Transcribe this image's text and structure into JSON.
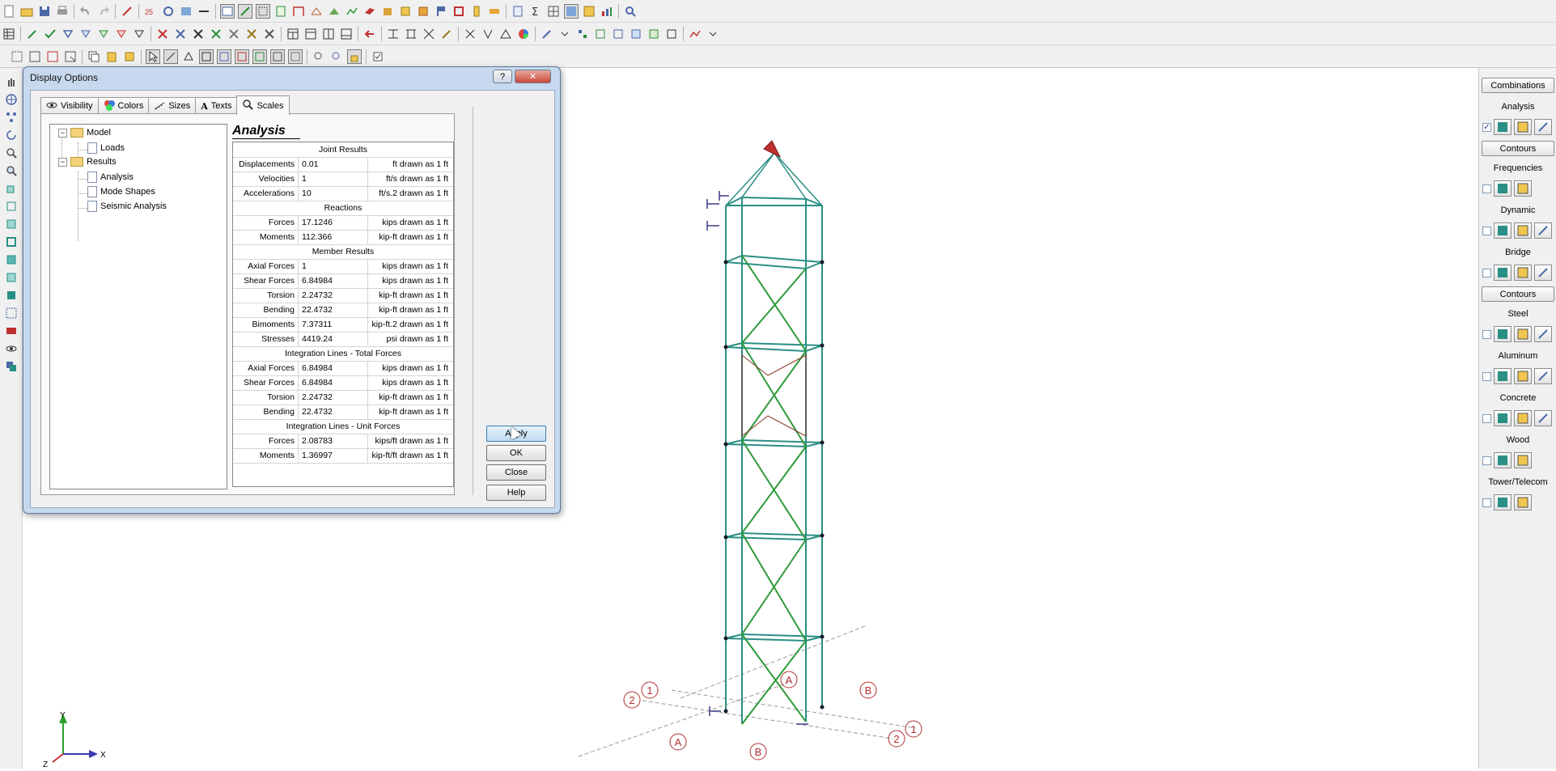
{
  "dialog": {
    "title": "Display Options",
    "help_glyph": "?",
    "close_glyph": "✕",
    "tabs": [
      {
        "label": "Visibility",
        "icon": "eye-icon"
      },
      {
        "label": "Colors",
        "icon": "palette-icon"
      },
      {
        "label": "Sizes",
        "icon": "ruler-icon"
      },
      {
        "label": "Texts",
        "icon": "text-a-icon"
      },
      {
        "label": "Scales",
        "icon": "magnifier-icon"
      }
    ],
    "active_tab": "Scales",
    "tree": [
      {
        "label": "Model",
        "type": "folder"
      },
      {
        "label": "Loads",
        "type": "doc"
      },
      {
        "label": "Results",
        "type": "folder"
      },
      {
        "label": "Analysis",
        "type": "doc",
        "selected": true
      },
      {
        "label": "Mode Shapes",
        "type": "doc"
      },
      {
        "label": "Seismic Analysis",
        "type": "doc"
      }
    ],
    "section_title": "Analysis",
    "grid": {
      "joint_header": "Joint Results",
      "displacements": {
        "label": "Displacements",
        "value": "0.01",
        "unit": "ft drawn as 1 ft"
      },
      "velocities": {
        "label": "Velocities",
        "value": "1",
        "unit": "ft/s drawn as 1 ft"
      },
      "accelerations": {
        "label": "Accelerations",
        "value": "10",
        "unit": "ft/s.2 drawn as 1 ft"
      },
      "reactions_header": "Reactions",
      "r_forces": {
        "label": "Forces",
        "value": "17.1246",
        "unit": "kips drawn as 1 ft"
      },
      "r_moments": {
        "label": "Moments",
        "value": "112.366",
        "unit": "kip-ft drawn as 1 ft"
      },
      "member_header": "Member Results",
      "m_axial": {
        "label": "Axial Forces",
        "value": "1",
        "unit": "kips drawn as 1 ft"
      },
      "m_shear": {
        "label": "Shear Forces",
        "value": "6.84984",
        "unit": "kips drawn as 1 ft"
      },
      "m_torsion": {
        "label": "Torsion",
        "value": "2.24732",
        "unit": "kip-ft drawn as 1 ft"
      },
      "m_bending": {
        "label": "Bending",
        "value": "22.4732",
        "unit": "kip-ft drawn as 1 ft"
      },
      "m_bimoments": {
        "label": "Bimoments",
        "value": "7.37311",
        "unit": "kip-ft.2 drawn as 1 ft"
      },
      "m_stresses": {
        "label": "Stresses",
        "value": "4419.24",
        "unit": "psi drawn as 1 ft"
      },
      "total_header": "Integration Lines - Total Forces",
      "t_axial": {
        "label": "Axial Forces",
        "value": "6.84984",
        "unit": "kips drawn as 1 ft"
      },
      "t_shear": {
        "label": "Shear Forces",
        "value": "6.84984",
        "unit": "kips drawn as 1 ft"
      },
      "t_torsion": {
        "label": "Torsion",
        "value": "2.24732",
        "unit": "kip-ft drawn as 1 ft"
      },
      "t_bending": {
        "label": "Bending",
        "value": "22.4732",
        "unit": "kip-ft drawn as 1 ft"
      },
      "unit_header": "Integration Lines - Unit Forces",
      "u_forces": {
        "label": "Forces",
        "value": "2.08783",
        "unit": "kips/ft drawn as 1 ft"
      },
      "u_moments": {
        "label": "Moments",
        "value": "1.36997",
        "unit": "kip-ft/ft drawn as 1 ft"
      }
    },
    "buttons": {
      "apply": "Apply",
      "ok": "OK",
      "close": "Close",
      "help": "Help"
    }
  },
  "right_panel": {
    "combinations": "Combinations",
    "analysis": "Analysis",
    "contours_1": "Contours",
    "frequencies": "Frequencies",
    "dynamic": "Dynamic",
    "bridge": "Bridge",
    "contours_2": "Contours",
    "steel": "Steel",
    "aluminum": "Aluminum",
    "concrete": "Concrete",
    "wood": "Wood",
    "tower": "Tower/Telecom"
  },
  "canvas": {
    "grid_labels": {
      "a_top": "A",
      "a_bottom": "A",
      "b_top": "B",
      "b_bottom": "B",
      "one_left": "1",
      "one_right": "1",
      "two_left": "2",
      "two_right": "2"
    },
    "axes": {
      "x": "X",
      "y": "Y",
      "z": "Z"
    }
  },
  "colors": {
    "member": "#2a8f84",
    "brace": "#2f9a3a",
    "grid_bubble": "#b03030"
  }
}
